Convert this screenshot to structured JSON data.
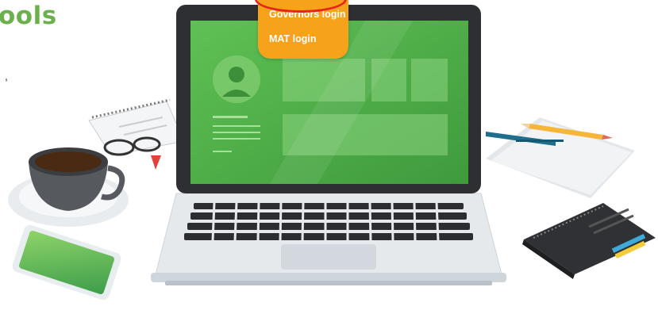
{
  "header": {
    "title_partial": "ools",
    "text_fragment": ","
  },
  "login_menu": {
    "items": [
      {
        "label": "Governors login"
      },
      {
        "label": "MAT login"
      }
    ]
  },
  "colors": {
    "brand_green": "#6ab04c",
    "menu_orange": "#f7a21b",
    "screen_green": "#5cb85c",
    "highlight_red": "#e8241a"
  },
  "illustration": {
    "objects": [
      "laptop-icon",
      "coffee-cup-icon",
      "phone-icon",
      "notebook-icon",
      "pen-icon",
      "pencil-icon",
      "glasses-icon",
      "spiral-notepad-icon",
      "paper-sheet-icon"
    ]
  }
}
